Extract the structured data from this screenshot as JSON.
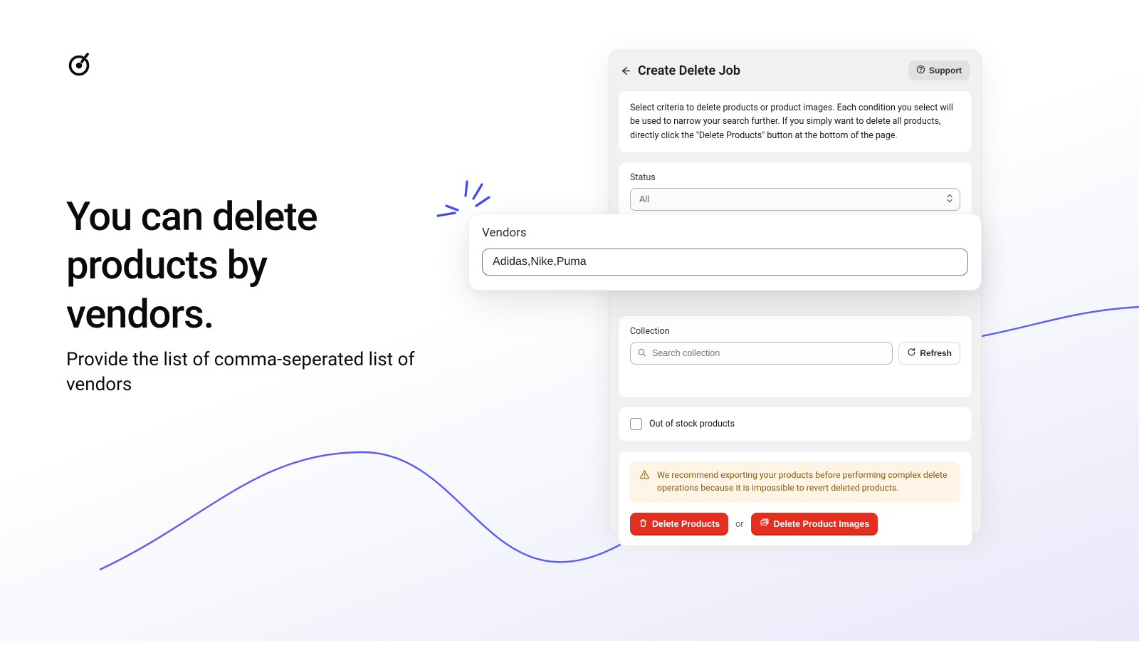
{
  "hero": {
    "title": "You can delete products by vendors.",
    "subtitle": "Provide the list of comma-seperated list of vendors"
  },
  "panel": {
    "title": "Create Delete Job",
    "support_label": "Support",
    "info_text": "Select criteria to delete products or product images. Each condition you select will be used to narrow your search further. If you simply want to delete all products, directly click the \"Delete Products\" button at the bottom of the page.",
    "status": {
      "label": "Status",
      "value": "All"
    },
    "vendors": {
      "label": "Vendors",
      "value": "Adidas,Nike,Puma"
    },
    "collection": {
      "label": "Collection",
      "placeholder": "Search collection",
      "refresh_label": "Refresh"
    },
    "out_of_stock_label": "Out of stock products",
    "warning_text": "We recommend exporting your products before performing complex delete operations because it is impossible to revert deleted products.",
    "actions": {
      "delete_products": "Delete Products",
      "or": "or",
      "delete_images": "Delete Product Images"
    }
  }
}
